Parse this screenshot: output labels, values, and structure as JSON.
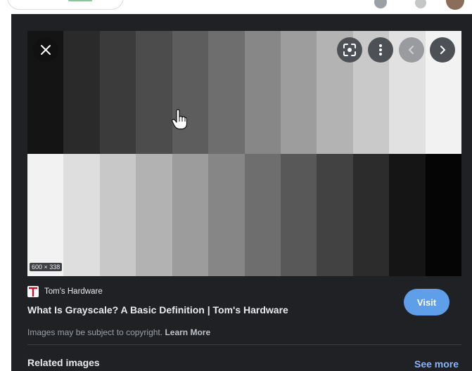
{
  "preview": {
    "size_label": "600 × 338",
    "top_row_colors": [
      "#141414",
      "#2a2a2a",
      "#3b3b3b",
      "#4c4c4c",
      "#5d5d5d",
      "#6e6e6e",
      "#878787",
      "#9d9d9d",
      "#b3b3b3",
      "#c9c9c9",
      "#e1e1e1",
      "#f2f2f2"
    ],
    "bottom_row_colors": [
      "#f2f2f2",
      "#dedede",
      "#c8c8c8",
      "#b2b2b2",
      "#9c9c9c",
      "#868686",
      "#6e6e6e",
      "#585858",
      "#424242",
      "#2c2c2c",
      "#151515",
      "#050505"
    ]
  },
  "controls": {
    "close_icon": "close-icon",
    "lens_icon": "lens-icon",
    "more_icon": "more-vertical-icon",
    "prev_icon": "chevron-left-icon",
    "next_icon": "chevron-right-icon"
  },
  "source": {
    "name": "Tom's Hardware",
    "favicon_icon": "toms-hardware-favicon",
    "favicon_color": "#c8102e"
  },
  "result": {
    "title": "What Is Grayscale? A Basic Definition | Tom's Hardware",
    "visit_label": "Visit",
    "visit_color": "#5f9ee8",
    "copyright_text": "Images may be subject to copyright.",
    "learn_more": "Learn More"
  },
  "related": {
    "heading": "Related images",
    "see_more": "See more",
    "link_color": "#8ab4f8"
  },
  "theme": {
    "panel_bg": "#202124"
  }
}
